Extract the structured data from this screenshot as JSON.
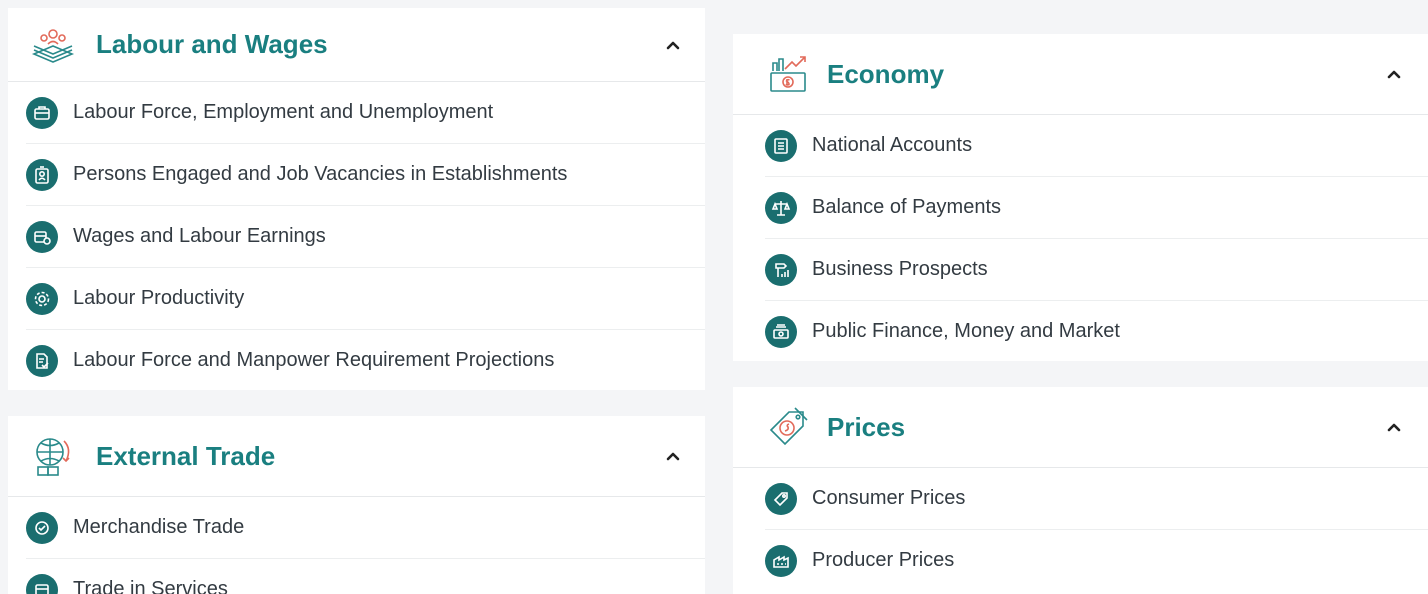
{
  "labour": {
    "title": "Labour and Wages",
    "icon": "labour-wages-icon",
    "items": [
      {
        "label": "Labour Force, Employment and Unemployment",
        "icon": "briefcase-icon"
      },
      {
        "label": "Persons Engaged and Job Vacancies in Establishments",
        "icon": "id-badge-icon"
      },
      {
        "label": "Wages and Labour Earnings",
        "icon": "wallet-coin-icon"
      },
      {
        "label": "Labour Productivity",
        "icon": "gear-cog-icon"
      },
      {
        "label": "Labour Force and Manpower Requirement Projections",
        "icon": "document-check-icon"
      }
    ]
  },
  "trade": {
    "title": "External Trade",
    "icon": "globe-trade-icon",
    "items": [
      {
        "label": "Merchandise Trade",
        "icon": "boxes-icon"
      },
      {
        "label": "Trade in Services",
        "icon": "services-icon"
      }
    ]
  },
  "economy": {
    "title": "Economy",
    "icon": "economy-chart-icon",
    "items": [
      {
        "label": "National Accounts",
        "icon": "ledger-icon"
      },
      {
        "label": "Balance of Payments",
        "icon": "scale-icon"
      },
      {
        "label": "Business Prospects",
        "icon": "signpost-chart-icon"
      },
      {
        "label": "Public Finance, Money and Market",
        "icon": "money-stack-icon"
      }
    ]
  },
  "prices": {
    "title": "Prices",
    "icon": "price-tag-icon",
    "items": [
      {
        "label": "Consumer Prices",
        "icon": "tag-icon"
      },
      {
        "label": "Producer Prices",
        "icon": "factory-icon"
      }
    ]
  },
  "colors": {
    "accent": "#1a7f80",
    "item_icon_bg": "#1a6e6f",
    "coral": "#e26a5a",
    "background": "#f4f5f7"
  }
}
